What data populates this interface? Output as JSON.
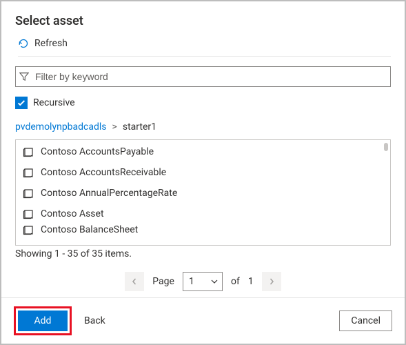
{
  "dialog": {
    "title": "Select asset"
  },
  "toolbar": {
    "refresh_label": "Refresh"
  },
  "filter": {
    "placeholder": "Filter by keyword",
    "value": ""
  },
  "recursive": {
    "checked": true,
    "label": "Recursive"
  },
  "breadcrumbs": {
    "root": "pvdemolynpbadcadls",
    "separator": ">",
    "current": "starter1"
  },
  "assets": [
    {
      "name": "Contoso AccountsPayable"
    },
    {
      "name": "Contoso AccountsReceivable"
    },
    {
      "name": "Contoso AnnualPercentageRate"
    },
    {
      "name": "Contoso Asset"
    },
    {
      "name": "Contoso BalanceSheet"
    }
  ],
  "status": {
    "text": "Showing 1 - 35 of 35 items."
  },
  "pagination": {
    "page_label": "Page",
    "current_page": "1",
    "of_label": "of",
    "total_pages": "1"
  },
  "footer": {
    "add_label": "Add",
    "back_label": "Back",
    "cancel_label": "Cancel"
  }
}
